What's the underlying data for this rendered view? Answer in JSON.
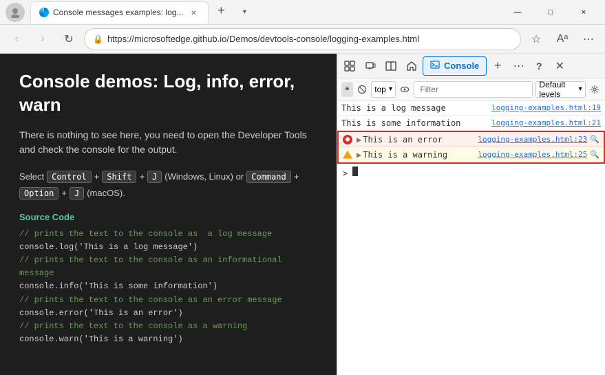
{
  "browser": {
    "title": "Console messages examples: log...",
    "url": "https://microsoftedge.github.io/Demos/devtools-console/logging-examples.html",
    "tab_close": "×",
    "new_tab": "+",
    "window_min": "—",
    "window_max": "□",
    "window_close": "×",
    "nav_back": "‹",
    "nav_forward": "›",
    "nav_refresh": "↻",
    "nav_lock": "🔒"
  },
  "page": {
    "title": "Console demos: Log, info, error, warn",
    "description": "There is nothing to see here, you need to open the Developer Tools and check the console for the output.",
    "shortcut_line1_parts": [
      "Select",
      "Control",
      "+",
      "Shift",
      "+",
      "J",
      "(Windows, Linux) or",
      "Command",
      "+"
    ],
    "shortcut_line2_parts": [
      "Option",
      "+",
      "J",
      "(macOS)."
    ],
    "source_code_label": "Source Code",
    "code_lines": [
      {
        "type": "comment",
        "text": "// prints the text to the console as  a log message"
      },
      {
        "type": "code",
        "text": "console.log('This is a log message')"
      },
      {
        "type": "comment",
        "text": "// prints the text to the console as an informational message"
      },
      {
        "type": "code",
        "text": "console.info('This is some information')"
      },
      {
        "type": "comment",
        "text": "// prints the text to the console as an error message"
      },
      {
        "type": "code",
        "text": "console.error('This is an error')"
      },
      {
        "type": "comment",
        "text": "// prints the text to the console as a warning"
      },
      {
        "type": "code",
        "text": "console.warn('This is a warning')"
      }
    ]
  },
  "devtools": {
    "toolbar_buttons": [
      "inspect",
      "device",
      "dock",
      "home",
      "console",
      "add",
      "more",
      "help",
      "close"
    ],
    "console_tab_label": "Console",
    "top_level_label": "top",
    "filter_placeholder": "Filter",
    "default_levels_label": "Default levels",
    "console_entries": [
      {
        "type": "log",
        "message": "This is a log message",
        "link": "logging-examples.html:19",
        "has_icon": false,
        "has_expand": false
      },
      {
        "type": "log",
        "message": "This is some information",
        "link": "logging-examples.html:21",
        "has_icon": false,
        "has_expand": false
      },
      {
        "type": "error",
        "message": "This is an error",
        "link": "logging-examples.html:23",
        "has_icon": true,
        "has_expand": true
      },
      {
        "type": "warning",
        "message": "This is a warning",
        "link": "logging-examples.html:25",
        "has_icon": true,
        "has_expand": true
      }
    ]
  },
  "colors": {
    "error_red": "#d93025",
    "warning_amber": "#f59e0b",
    "error_bg": "#fff0f0",
    "warning_bg": "#fffbe6",
    "log_bg": "#fff",
    "link_blue": "#1a73e8",
    "code_green": "#4ec9b0"
  }
}
